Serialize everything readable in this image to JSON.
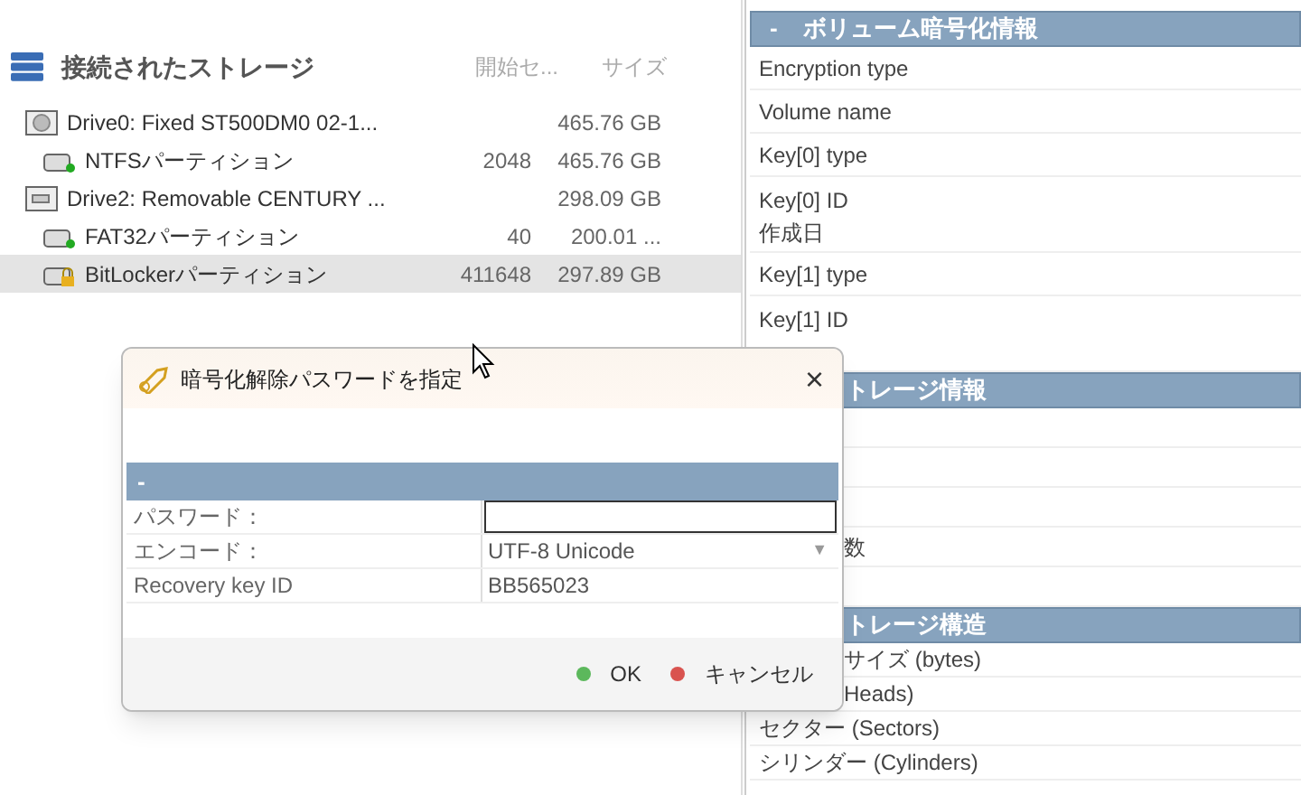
{
  "storage": {
    "title": "接続されたストレージ",
    "columns": [
      "開始セ...",
      "サイズ"
    ],
    "items": [
      {
        "kind": "hdd",
        "name": "Drive0: Fixed ST500DM0 02-1...",
        "size": "465.76 GB",
        "selected": false,
        "children": [
          {
            "kind": "partition",
            "name": "NTFSパーティション",
            "start": "2048",
            "size": "465.76 GB",
            "selected": false
          }
        ]
      },
      {
        "kind": "removable",
        "name": "Drive2: Removable CENTURY ...",
        "size": "298.09 GB",
        "selected": false,
        "children": [
          {
            "kind": "partition",
            "name": "FAT32パーティション",
            "start": "40",
            "size": "200.01 ...",
            "selected": false
          },
          {
            "kind": "locked",
            "name": "BitLockerパーティション",
            "start": "411648",
            "size": "297.89 GB",
            "selected": true
          }
        ]
      }
    ]
  },
  "details": [
    {
      "toggle": "-",
      "title": "ボリューム暗号化情報",
      "rows": [
        {
          "kind": "plain",
          "label": "Encryption type"
        },
        {
          "kind": "plain",
          "label": "Volume name"
        },
        {
          "kind": "plain",
          "label": "Key[0] type"
        },
        {
          "kind": "plain",
          "label": "Key[0] ID",
          "sub": "作成日"
        },
        {
          "kind": "plain",
          "label": "Key[1] type"
        },
        {
          "kind": "tall",
          "label": "Key[1] ID"
        }
      ]
    },
    {
      "title": "トレージ情報",
      "rows": [
        {
          "kind": "covered"
        },
        {
          "kind": "covered"
        },
        {
          "kind": "covered"
        },
        {
          "kind": "covered",
          "label": "数"
        },
        {
          "kind": "covered"
        }
      ]
    },
    {
      "title": "トレージ構造",
      "rows": [
        {
          "kind": "covered",
          "label": "サイズ (bytes)"
        },
        {
          "kind": "covered",
          "label": "Heads)"
        },
        {
          "kind": "plain",
          "label": "セクター (Sectors)"
        },
        {
          "kind": "plain",
          "label": "シリンダー (Cylinders)"
        },
        {
          "kind": "plain"
        }
      ]
    }
  ],
  "dialog": {
    "title": "暗号化解除パスワードを指定",
    "close": "×",
    "section": "-",
    "fields": [
      {
        "kind": "password",
        "label": "パスワード："
      },
      {
        "kind": "select",
        "label": "エンコード：",
        "value": "UTF-8 Unicode",
        "arrow": "▼"
      },
      {
        "kind": "text",
        "label": "Recovery key ID",
        "value": "BB565023"
      }
    ],
    "buttons": [
      {
        "label": "OK",
        "color": "#5cb85c"
      },
      {
        "label": "キャンセル",
        "color": "#d9534f"
      }
    ]
  }
}
